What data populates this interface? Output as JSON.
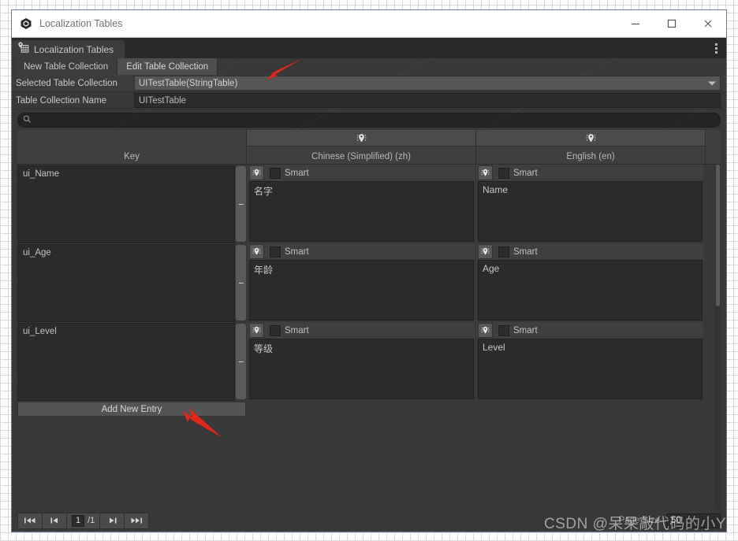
{
  "window": {
    "title": "Localization Tables",
    "logo_icon": "unity-hexagon-icon",
    "minimize_icon": "minimize-icon",
    "maximize_icon": "maximize-icon",
    "close_icon": "close-icon"
  },
  "tab": {
    "label": "Localization Tables",
    "icon": "localization-pin-grid-icon",
    "menu_icon": "kebab-menu-icon"
  },
  "toolbar": {
    "new_table_collection": "New Table Collection",
    "edit_table_collection": "Edit Table Collection",
    "active": "Edit Table Collection"
  },
  "fields": {
    "selected_table_collection_label": "Selected Table Collection",
    "selected_table_collection_value": "UITestTable(StringTable)",
    "table_collection_name_label": "Table Collection Name",
    "table_collection_name_value": "UITestTable",
    "dropdown_icon": "chevron-down-icon"
  },
  "search": {
    "icon": "search-icon",
    "value": "",
    "placeholder": ""
  },
  "table": {
    "gear_icon": "localization-settings-icon",
    "columns": [
      {
        "id": "key",
        "label": "Key"
      },
      {
        "id": "zh",
        "label": "Chinese (Simplified) (zh)"
      },
      {
        "id": "en",
        "label": "English (en)"
      }
    ],
    "smart_label": "Smart",
    "remove_handle_icon": "minus-handle-icon",
    "rows": [
      {
        "key": "ui_Name",
        "zh": {
          "smart": false,
          "value": "名字"
        },
        "en": {
          "smart": false,
          "value": "Name"
        }
      },
      {
        "key": "ui_Age",
        "zh": {
          "smart": false,
          "value": "年龄"
        },
        "en": {
          "smart": false,
          "value": "Age"
        }
      },
      {
        "key": "ui_Level",
        "zh": {
          "smart": false,
          "value": "等级"
        },
        "en": {
          "smart": false,
          "value": "Level"
        }
      }
    ],
    "add_new_entry": "Add New Entry"
  },
  "footer": {
    "first_page_icon": "skip-to-first-icon",
    "prev_page_icon": "step-back-icon",
    "next_page_icon": "step-forward-icon",
    "last_page_icon": "skip-to-last-icon",
    "current_page": "1",
    "total_pages": "/1",
    "page_size_label": "Page Size",
    "page_size_value": "50"
  },
  "annotations": {
    "arrow_color": "#e1261c",
    "watermark": "CSDN @呆呆敲代码的小Y"
  }
}
